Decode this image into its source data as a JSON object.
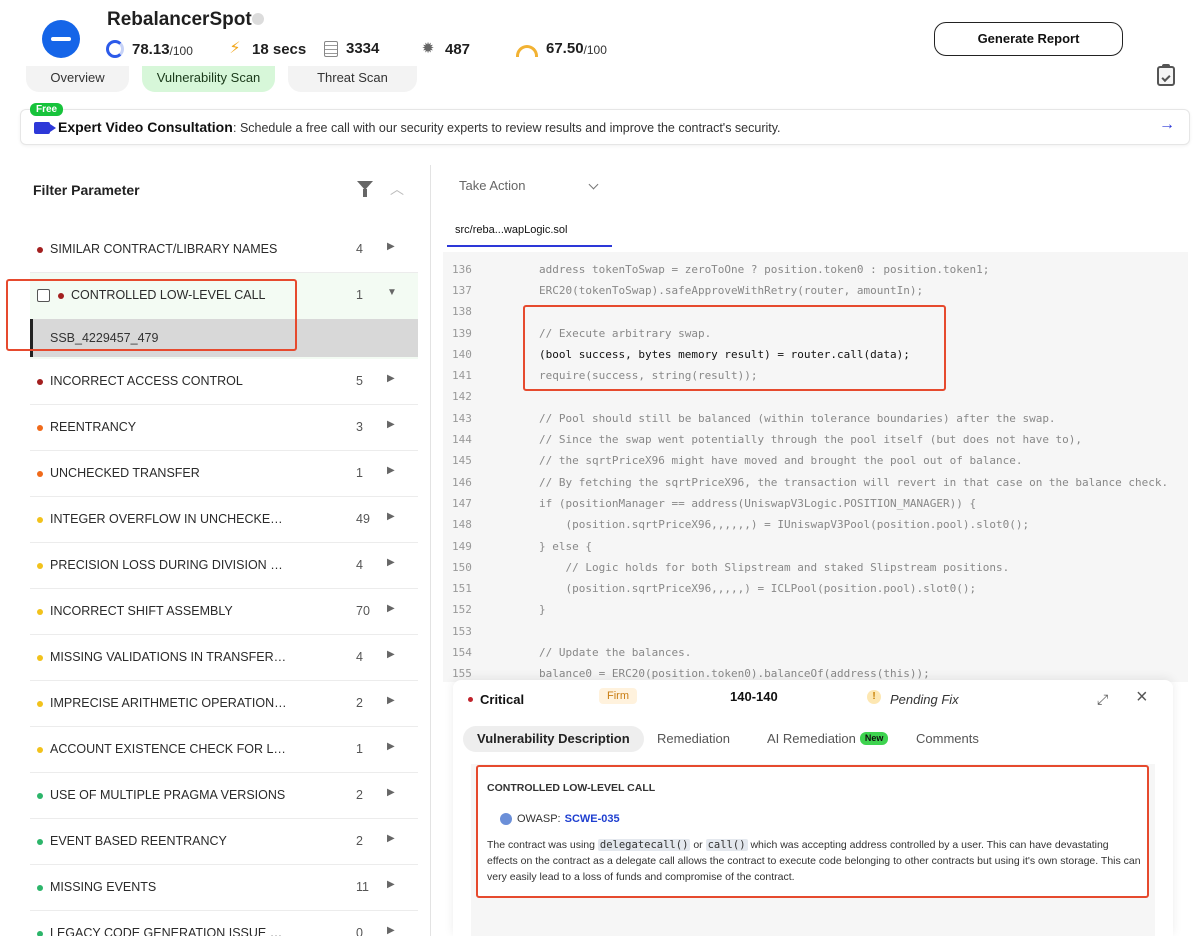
{
  "header": {
    "title": "RebalancerSpot",
    "generate_button": "Generate Report",
    "stats": [
      {
        "icon": "score-ring-icon",
        "value": "78.13",
        "suffix": "/100"
      },
      {
        "icon": "lightning-icon",
        "value": "18 secs",
        "suffix": ""
      },
      {
        "icon": "document-icon",
        "value": "3334",
        "suffix": ""
      },
      {
        "icon": "bug-icon",
        "value": "487",
        "suffix": ""
      },
      {
        "icon": "gauge-icon",
        "value": "67.50",
        "suffix": "/100"
      }
    ]
  },
  "tabs": [
    {
      "label": "Overview",
      "active": false
    },
    {
      "label": "Vulnerability Scan",
      "active": true
    },
    {
      "label": "Threat Scan",
      "active": false
    }
  ],
  "banner": {
    "badge": "Free",
    "title": "Expert Video Consultation",
    "text": ": Schedule a free call with our security experts to review results and improve the contract's security."
  },
  "filter": {
    "title": "Filter Parameter",
    "items": [
      {
        "label": "SIMILAR CONTRACT/LIBRARY NAMES",
        "count": "4",
        "color": "#a31f1f"
      },
      {
        "label": "CONTROLLED LOW-LEVEL CALL",
        "count": "1",
        "color": "#a31f1f",
        "expanded": true,
        "child": "SSB_4229457_479"
      },
      {
        "label": "INCORRECT ACCESS CONTROL",
        "count": "5",
        "color": "#a31f1f"
      },
      {
        "label": "REENTRANCY",
        "count": "3",
        "color": "#f06a1a"
      },
      {
        "label": "UNCHECKED TRANSFER",
        "count": "1",
        "color": "#f06a1a"
      },
      {
        "label": "INTEGER OVERFLOW IN UNCHECKED ...",
        "count": "49",
        "color": "#f2c21b"
      },
      {
        "label": "PRECISION LOSS DURING DIVISION BY...",
        "count": "4",
        "color": "#f2c21b"
      },
      {
        "label": "INCORRECT SHIFT ASSEMBLY",
        "count": "70",
        "color": "#f2c21b"
      },
      {
        "label": "MISSING VALIDATIONS IN TRANSFERH...",
        "count": "4",
        "color": "#f2c21b"
      },
      {
        "label": "IMPRECISE ARITHMETIC OPERATIONS ...",
        "count": "2",
        "color": "#f2c21b"
      },
      {
        "label": "ACCOUNT EXISTENCE CHECK FOR LO...",
        "count": "1",
        "color": "#f2c21b"
      },
      {
        "label": "USE OF MULTIPLE PRAGMA VERSIONS",
        "count": "2",
        "color": "#2cb56a"
      },
      {
        "label": "EVENT BASED REENTRANCY",
        "count": "2",
        "color": "#2cb56a"
      },
      {
        "label": "MISSING EVENTS",
        "count": "11",
        "color": "#2cb56a"
      },
      {
        "label": "LEGACY CODE GENERATION ISSUE WI...",
        "count": "0",
        "color": "#2cb56a"
      }
    ]
  },
  "editor": {
    "take_action": "Take Action",
    "file_tab": "src/reba...wapLogic.sol",
    "lines": [
      {
        "n": "136",
        "code": "address tokenToSwap = zeroToOne ? position.token0 : position.token1;"
      },
      {
        "n": "137",
        "code": "ERC20(tokenToSwap).safeApproveWithRetry(router, amountIn);"
      },
      {
        "n": "138",
        "code": ""
      },
      {
        "n": "139",
        "code": "// Execute arbitrary swap."
      },
      {
        "n": "140",
        "code": "(bool success, bytes memory result) = router.call(data);",
        "highlight": true
      },
      {
        "n": "141",
        "code": "require(success, string(result));"
      },
      {
        "n": "142",
        "code": ""
      },
      {
        "n": "143",
        "code": "// Pool should still be balanced (within tolerance boundaries) after the swap."
      },
      {
        "n": "144",
        "code": "// Since the swap went potentially through the pool itself (but does not have to),"
      },
      {
        "n": "145",
        "code": "// the sqrtPriceX96 might have moved and brought the pool out of balance."
      },
      {
        "n": "146",
        "code": "// By fetching the sqrtPriceX96, the transaction will revert in that case on the balance check."
      },
      {
        "n": "147",
        "code": "if (positionManager == address(UniswapV3Logic.POSITION_MANAGER)) {"
      },
      {
        "n": "148",
        "code": "    (position.sqrtPriceX96,,,,,,) = IUniswapV3Pool(position.pool).slot0();"
      },
      {
        "n": "149",
        "code": "} else {"
      },
      {
        "n": "150",
        "code": "    // Logic holds for both Slipstream and staked Slipstream positions."
      },
      {
        "n": "151",
        "code": "    (position.sqrtPriceX96,,,,,) = ICLPool(position.pool).slot0();"
      },
      {
        "n": "152",
        "code": "}"
      },
      {
        "n": "153",
        "code": ""
      },
      {
        "n": "154",
        "code": "// Update the balances."
      },
      {
        "n": "155",
        "code": "balance0 = ERC20(position.token0).balanceOf(address(this));"
      }
    ]
  },
  "detail": {
    "severity": "Critical",
    "confidence": "Firm",
    "lines": "140-140",
    "status": "Pending Fix",
    "tabs": [
      "Vulnerability Description",
      "Remediation",
      "AI Remediation",
      "Comments"
    ],
    "new_badge": "New",
    "vuln_title": "CONTROLLED LOW-LEVEL CALL",
    "owasp_label": "OWASP:",
    "owasp_id": "SCWE-035",
    "desc_part1": "The contract was using",
    "desc_code1": "delegatecall()",
    "desc_or": "or",
    "desc_code2": "call()",
    "desc_part2": "which was accepting address controlled by a user. This can have devastating effects on the contract as a delegate call allows the contract to execute code belonging to other contracts but using it's own storage. This can very easily lead to a loss of funds and compromise of the contract."
  }
}
